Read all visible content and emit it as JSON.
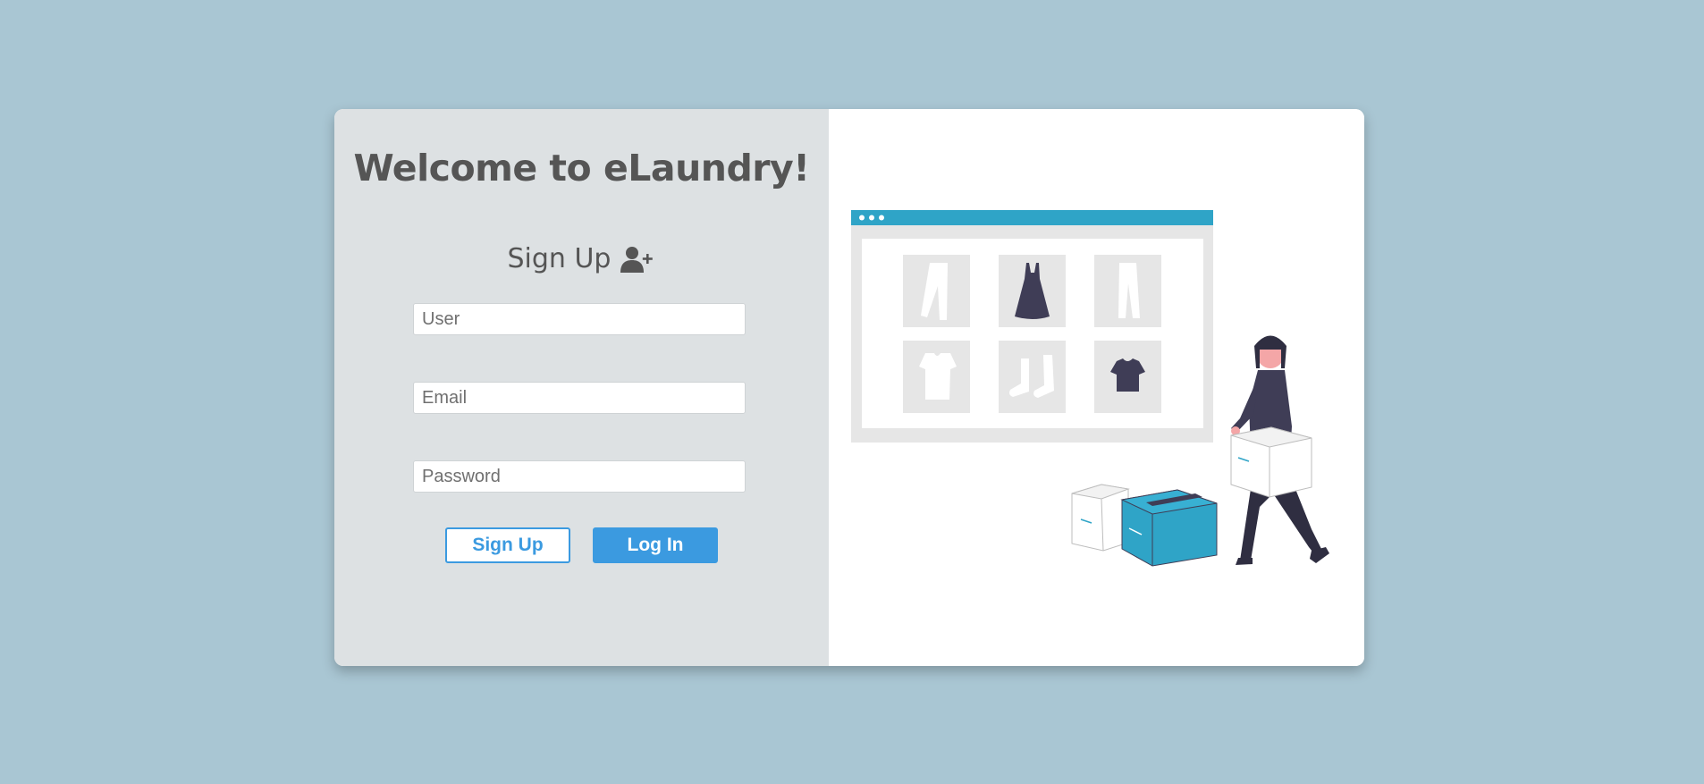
{
  "login": {
    "title": "Welcome to eLaundry!",
    "signup_heading": "Sign Up",
    "user_icon": "user-plus-icon",
    "fields": {
      "user_placeholder": "User",
      "email_placeholder": "Email",
      "password_placeholder": "Password"
    },
    "buttons": {
      "signup_label": "Sign Up",
      "login_label": "Log In"
    }
  },
  "colors": {
    "background": "#a9c6d3",
    "panel": "#dde1e3",
    "accent": "#3b9ae0",
    "illustration_teal": "#2fa4c7",
    "illustration_dark": "#3f3d56"
  },
  "illustration": {
    "name": "online-shopping-illustration",
    "icons": [
      "pants-icon",
      "dress-icon",
      "trousers-icon",
      "tshirt-icon",
      "socks-icon",
      "shirt-icon"
    ]
  }
}
